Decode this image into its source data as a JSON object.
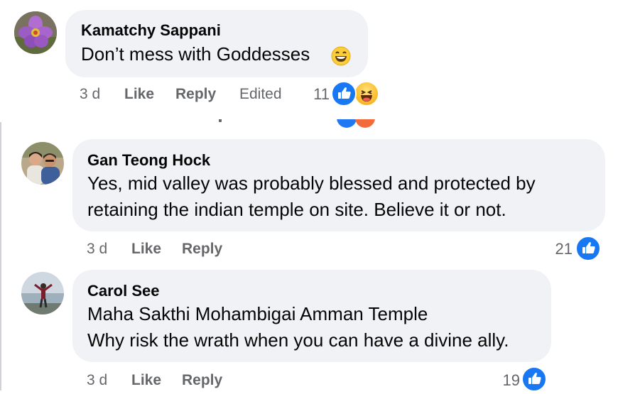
{
  "comments": [
    {
      "author": "Kamatchy Sappani",
      "text_lines": [
        "Don’t mess with Goddesses"
      ],
      "time": "3 d",
      "like_label": "Like",
      "reply_label": "Reply",
      "edited_label": "Edited",
      "reaction_count": "11",
      "reactions": [
        "like-icon",
        "haha-icon"
      ],
      "avatar": "purple-flower-avatar",
      "inline_emoji": "grinning-face-emoji"
    },
    {
      "author": "Gan Teong Hock",
      "text_lines": [
        "Yes, mid valley was probably blessed and protected by",
        "retaining the indian temple on site. Believe it or not."
      ],
      "time": "3 d",
      "like_label": "Like",
      "reply_label": "Reply",
      "reaction_count": "21",
      "reactions": [
        "like-icon"
      ],
      "avatar": "couple-photo-avatar"
    },
    {
      "author": "Carol See",
      "text_lines": [
        "Maha Sakthi Mohambigai Amman Temple",
        "Why risk the wrath when you can have a divine ally."
      ],
      "time": "3 d",
      "like_label": "Like",
      "reply_label": "Reply",
      "reaction_count": "19",
      "reactions": [
        "like-icon"
      ],
      "avatar": "person-by-sea-avatar"
    }
  ],
  "colors": {
    "bubble": "#f0f2f5",
    "meta_text": "#65676b",
    "like_blue": "#1877f2",
    "text": "#050505"
  }
}
